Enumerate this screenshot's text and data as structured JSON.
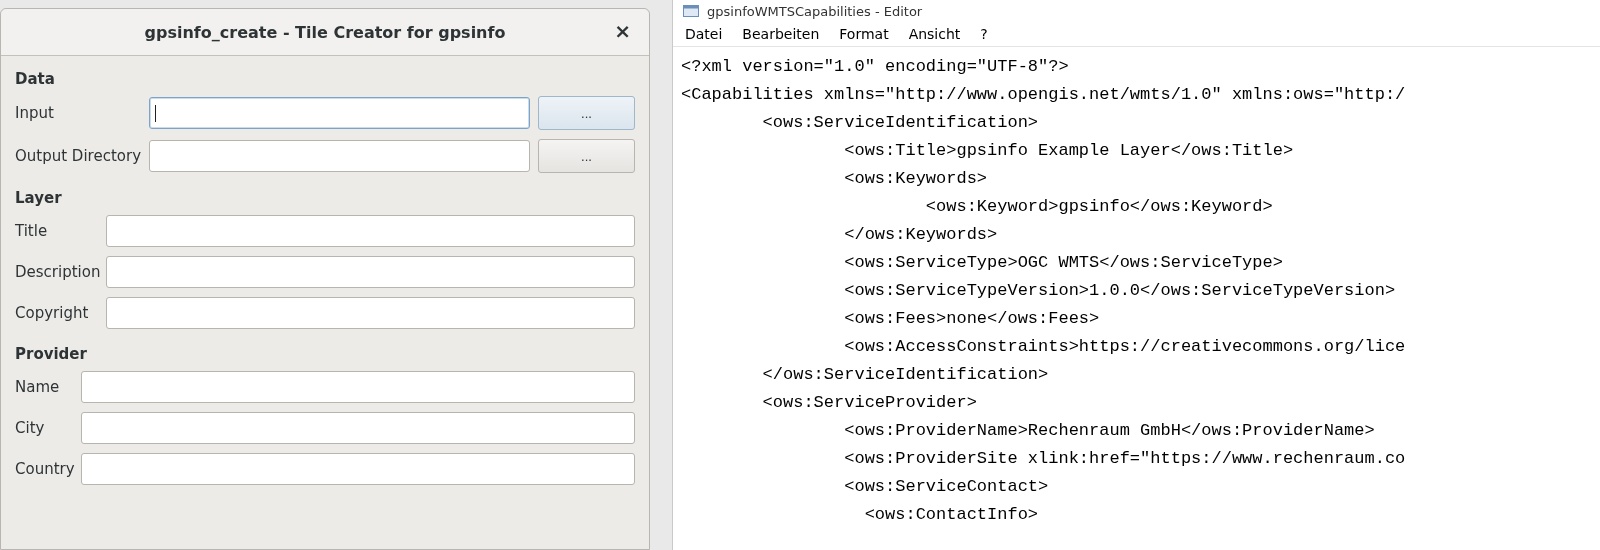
{
  "dialog": {
    "title": "gpsinfo_create - Tile Creator for gpsinfo",
    "close": "×",
    "sections": [
      {
        "heading": "Data",
        "fields": [
          {
            "label": "Input",
            "focused": true,
            "browse_button": "..."
          },
          {
            "label": "Output Directory",
            "focused": false,
            "browse_button": "..."
          }
        ]
      },
      {
        "heading": "Layer",
        "fields": [
          {
            "label": "Title",
            "focused": false
          },
          {
            "label": "Description",
            "focused": false
          },
          {
            "label": "Copyright",
            "focused": false
          }
        ]
      },
      {
        "heading": "Provider",
        "fields": [
          {
            "label": "Name",
            "focused": false
          },
          {
            "label": "City",
            "focused": false
          },
          {
            "label": "Country",
            "focused": false
          }
        ]
      }
    ]
  },
  "editor": {
    "title": "gpsinfoWMTSCapabilities - Editor",
    "menu": [
      "Datei",
      "Bearbeiten",
      "Format",
      "Ansicht",
      "?"
    ],
    "lines": [
      "<?xml version=\"1.0\" encoding=\"UTF-8\"?>",
      "<Capabilities xmlns=\"http://www.opengis.net/wmts/1.0\" xmlns:ows=\"http:/",
      "        <ows:ServiceIdentification>",
      "                <ows:Title>gpsinfo Example Layer</ows:Title>",
      "                <ows:Keywords>",
      "                        <ows:Keyword>gpsinfo</ows:Keyword>",
      "                </ows:Keywords>",
      "                <ows:ServiceType>OGC WMTS</ows:ServiceType>",
      "                <ows:ServiceTypeVersion>1.0.0</ows:ServiceTypeVersion>",
      "                <ows:Fees>none</ows:Fees>",
      "                <ows:AccessConstraints>https://creativecommons.org/lice",
      "        </ows:ServiceIdentification>",
      "        <ows:ServiceProvider>",
      "                <ows:ProviderName>Rechenraum GmbH</ows:ProviderName>",
      "                <ows:ProviderSite xlink:href=\"https://www.rechenraum.co",
      "                <ows:ServiceContact>",
      "                  <ows:ContactInfo>"
    ]
  }
}
